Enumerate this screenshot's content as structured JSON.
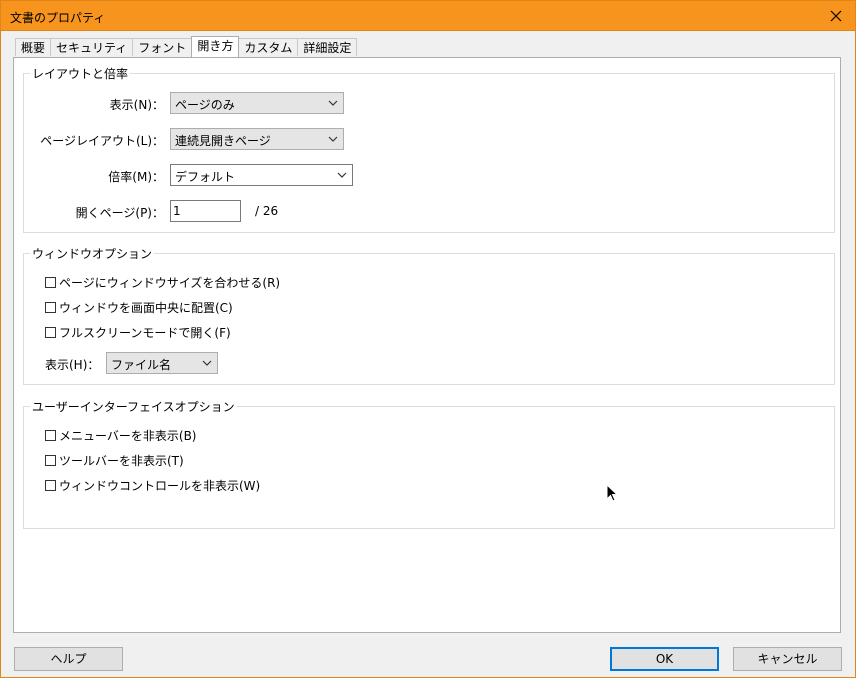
{
  "window": {
    "title": "文書のプロパティ"
  },
  "tabs": [
    "概要",
    "セキュリティ",
    "フォント",
    "開き方",
    "カスタム",
    "詳細設定"
  ],
  "layout_group": {
    "title": "レイアウトと倍率",
    "display_label": "表示(N)：",
    "display_value": "ページのみ",
    "page_layout_label": "ページレイアウト(L)：",
    "page_layout_value": "連続見開きページ",
    "zoom_label": "倍率(M)：",
    "zoom_value": "デフォルト",
    "open_page_label": "開くページ(P)：",
    "open_page_value": "1",
    "open_page_total": "/ 26"
  },
  "window_group": {
    "title": "ウィンドウオプション",
    "fit_window": "ページにウィンドウサイズを合わせる(R)",
    "center_window": "ウィンドウを画面中央に配置(C)",
    "fullscreen": "フルスクリーンモードで開く(F)",
    "show_label": "表示(H)：",
    "show_value": "ファイル名"
  },
  "ui_group": {
    "title": "ユーザーインターフェイスオプション",
    "hide_menubar": "メニューバーを非表示(B)",
    "hide_toolbar": "ツールバーを非表示(T)",
    "hide_window_controls": "ウィンドウコントロールを非表示(W)"
  },
  "buttons": {
    "help": "ヘルプ",
    "ok": "OK",
    "cancel": "キャンセル"
  },
  "icons": {
    "close": "close-icon",
    "dropdown": "chevron-down-icon",
    "cursor": "mouse-pointer-icon"
  },
  "colors": {
    "titlebar": "#f7941d",
    "focus": "#0078d7"
  }
}
